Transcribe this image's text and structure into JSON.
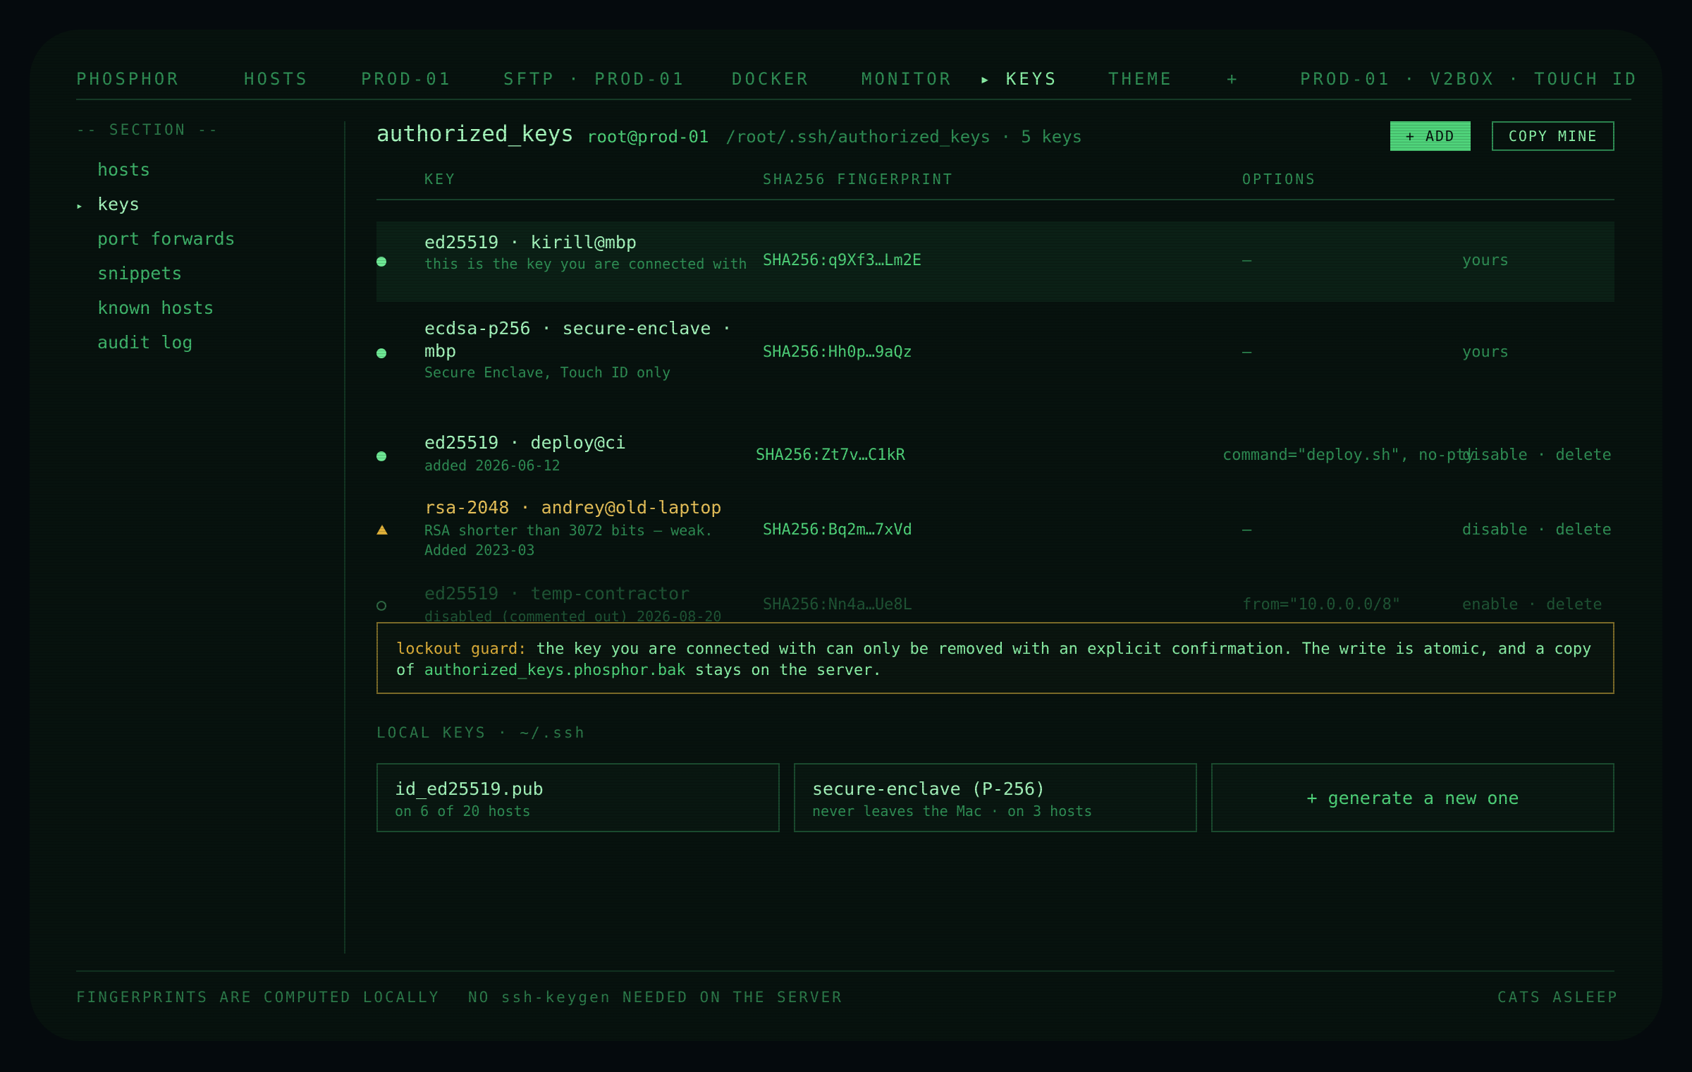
{
  "nav": {
    "brand": "PHOSPHOR",
    "hosts": "HOSTS",
    "prod": "PROD-01",
    "sftp": "SFTP · PROD-01",
    "docker": "DOCKER",
    "monitor": "MONITOR",
    "keys": "▸ KEYS",
    "theme": "THEME",
    "plus": "+",
    "status": "PROD-01 · V2BOX · TOUCH ID"
  },
  "sidebar": {
    "heading": "-- SECTION --",
    "marker": "▸",
    "items": [
      {
        "label": "hosts"
      },
      {
        "label": "keys"
      },
      {
        "label": "port forwards"
      },
      {
        "label": "snippets"
      },
      {
        "label": "known hosts"
      },
      {
        "label": "audit log"
      }
    ]
  },
  "header": {
    "title": "authorized_keys",
    "host": "root@prod-01",
    "path": "/root/.ssh/authorized_keys · 5 keys",
    "add_label": "+ ADD",
    "copy_label": "COPY MINE"
  },
  "table": {
    "columns": [
      "KEY",
      "SHA256 FINGERPRINT",
      "OPTIONS"
    ],
    "rows": [
      {
        "name": "ed25519 · kirill@mbp",
        "sub": "this is the key you are connected with",
        "fingerprint": "SHA256:q9Xf3…Lm2E",
        "options": "—",
        "actions": "yours",
        "status": "connected"
      },
      {
        "name": "ecdsa-p256 · secure-enclave · mbp",
        "sub": "Secure Enclave, Touch ID only",
        "fingerprint": "SHA256:Hh0p…9aQz",
        "options": "—",
        "actions": "yours",
        "status": "active"
      },
      {
        "name": "ed25519 · deploy@ci",
        "sub": "added 2026-06-12",
        "fingerprint": "SHA256:Zt7v…C1kR",
        "options": "command=\"deploy.sh\", no-pty",
        "actions": "disable · delete",
        "status": "active"
      },
      {
        "name": "rsa-2048 · andrey@old-laptop",
        "sub": "RSA shorter than 3072 bits — weak. Added 2023-03",
        "fingerprint": "SHA256:Bq2m…7xVd",
        "options": "—",
        "actions": "disable · delete",
        "status": "weak"
      },
      {
        "name": "ed25519 · temp-contractor",
        "sub": "disabled (commented out) 2026-08-20",
        "fingerprint": "SHA256:Nn4a…Ue8L",
        "options": "from=\"10.0.0.0/8\"",
        "actions": "enable · delete",
        "status": "disabled"
      }
    ]
  },
  "lockout": {
    "label": "lockout guard:",
    "text_before": " the key you are connected with can only be removed with an explicit confirmation. The write is atomic, and a copy of ",
    "file": "authorized_keys.phosphor.bak",
    "text_after": " stays on the server."
  },
  "local_keys": {
    "heading": "LOCAL KEYS · ~/.ssh",
    "cards": [
      {
        "title": "id_ed25519.pub",
        "sub": "on 6 of 20 hosts"
      },
      {
        "title": "secure-enclave (P-256)",
        "sub": "never leaves the Mac · on 3 hosts"
      }
    ],
    "generate": "+ generate a new one"
  },
  "footer": {
    "left1": "FINGERPRINTS ARE COMPUTED LOCALLY",
    "left2": "NO ssh-keygen NEEDED ON THE SERVER",
    "right": "CATS ASLEEP"
  },
  "colors": {
    "background": "#07120e",
    "accent": "#4fd37a",
    "bright": "#a6f7bd",
    "warning": "#e0b13a"
  }
}
